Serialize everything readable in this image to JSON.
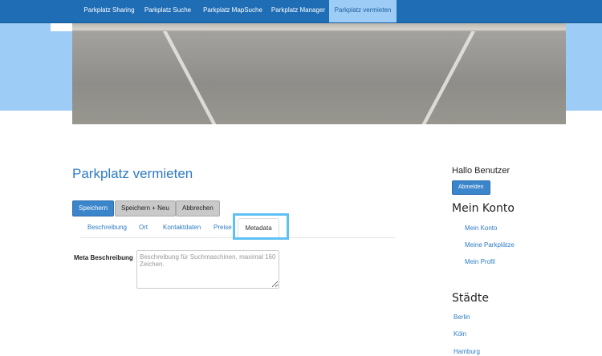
{
  "nav": {
    "items": [
      {
        "label": "Parkplatz Sharing"
      },
      {
        "label": "Parkplatz Suche"
      },
      {
        "label": "Parkplatz MapSuche"
      },
      {
        "label": "Parkplatz Manager"
      },
      {
        "label": "Parkplatz vermieten",
        "active": true
      }
    ]
  },
  "main": {
    "title": "Parkplatz vermieten",
    "buttons": {
      "save": "Speichern",
      "save_new": "Speichern + Neu",
      "cancel": "Abbrechen"
    },
    "tabs": [
      {
        "label": "Beschreibung"
      },
      {
        "label": "Ort"
      },
      {
        "label": "Kontaktdaten"
      },
      {
        "label": "Preise"
      },
      {
        "label": "Metadata",
        "active": true
      }
    ],
    "meta_label": "Meta Beschreibung",
    "meta_placeholder": "Beschreibung für Suchmaschinen, maximal 160 Zeichen.",
    "meta_value": ""
  },
  "sidebar": {
    "greeting": "Hallo Benutzer",
    "logout": "Abmelden",
    "account_title": "Mein Konto",
    "account_links": [
      {
        "label": "Mein Konto"
      },
      {
        "label": "Meine Parkplätze"
      },
      {
        "label": "Mein Profil"
      }
    ],
    "cities_title": "Städte",
    "cities": [
      {
        "label": "Berlin"
      },
      {
        "label": "Köln"
      },
      {
        "label": "Hamburg"
      }
    ]
  },
  "colors": {
    "navbar": "#1f6db5",
    "accent": "#2e7bc4",
    "band": "#9dccf6",
    "highlight": "#5ec0f5"
  }
}
